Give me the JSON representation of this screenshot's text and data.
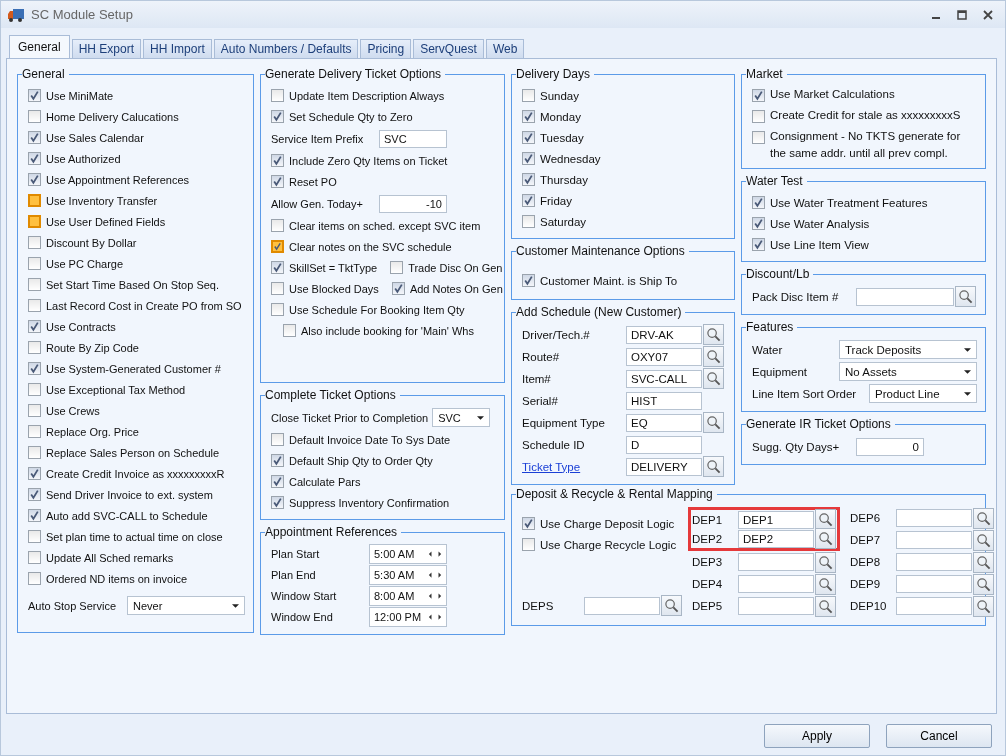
{
  "window": {
    "title": "SC Module Setup"
  },
  "tabs": [
    {
      "label": "General",
      "selected": true
    },
    {
      "label": "HH Export",
      "selected": false
    },
    {
      "label": "HH Import",
      "selected": false
    },
    {
      "label": "Auto Numbers / Defaults",
      "selected": false
    },
    {
      "label": "Pricing",
      "selected": false
    },
    {
      "label": "ServQuest",
      "selected": false
    },
    {
      "label": "Web",
      "selected": false
    }
  ],
  "general": {
    "title": "General",
    "items": [
      {
        "label": "Use MiniMate",
        "checked": true,
        "highlighted": false
      },
      {
        "label": "Home Delivery Calucations",
        "checked": false,
        "highlighted": false
      },
      {
        "label": "Use Sales Calendar",
        "checked": true,
        "highlighted": false
      },
      {
        "label": "Use Authorized",
        "checked": true,
        "highlighted": false
      },
      {
        "label": "Use Appointment References",
        "checked": true,
        "highlighted": false
      },
      {
        "label": "Use Inventory Transfer",
        "checked": false,
        "highlighted": true
      },
      {
        "label": "Use User Defined Fields",
        "checked": false,
        "highlighted": true
      },
      {
        "label": "Discount By Dollar",
        "checked": false,
        "highlighted": false
      },
      {
        "label": "Use PC Charge",
        "checked": false,
        "highlighted": false
      },
      {
        "label": "Set Start Time Based On Stop Seq.",
        "checked": false,
        "highlighted": false
      },
      {
        "label": "Last Record Cost in Create PO from SO",
        "checked": false,
        "highlighted": false
      },
      {
        "label": "Use Contracts",
        "checked": true,
        "highlighted": false
      },
      {
        "label": "Route By Zip Code",
        "checked": false,
        "highlighted": false
      },
      {
        "label": "Use System-Generated Customer #",
        "checked": true,
        "highlighted": false
      },
      {
        "label": "Use Exceptional Tax Method",
        "checked": false,
        "highlighted": false
      },
      {
        "label": "Use Crews",
        "checked": false,
        "highlighted": false
      },
      {
        "label": "Replace Org. Price",
        "checked": false,
        "highlighted": false
      },
      {
        "label": "Replace Sales Person on Schedule",
        "checked": false,
        "highlighted": false
      },
      {
        "label": "Create Credit Invoice as xxxxxxxxxR",
        "checked": true,
        "highlighted": false
      },
      {
        "label": "Send Driver Invoice to ext. system",
        "checked": true,
        "highlighted": false
      },
      {
        "label": "Auto add SVC-CALL to Schedule",
        "checked": true,
        "highlighted": false
      },
      {
        "label": "Set plan time to actual time on close",
        "checked": false,
        "highlighted": false
      },
      {
        "label": "Update All Sched remarks",
        "checked": false,
        "highlighted": false
      },
      {
        "label": "Ordered ND items on invoice",
        "checked": false,
        "highlighted": false
      }
    ],
    "dropdown": {
      "label": "Auto Stop Service",
      "value": "Never"
    }
  },
  "delivery_ticket": {
    "title": "Generate Delivery Ticket Options",
    "rows": [
      {
        "kind": "checkbox",
        "label": "Update Item Description Always",
        "checked": false,
        "highlighted": false
      },
      {
        "kind": "checkbox",
        "label": "Set Schedule Qty to Zero",
        "checked": true,
        "highlighted": false
      },
      {
        "kind": "field",
        "label": "Service Item Prefix",
        "value": "SVC"
      },
      {
        "kind": "checkbox",
        "label": "Include Zero Qty Items on Ticket",
        "checked": true,
        "highlighted": false
      },
      {
        "kind": "checkbox",
        "label": "Reset PO",
        "checked": true,
        "highlighted": false
      },
      {
        "kind": "number",
        "label": "Allow Gen. Today+",
        "value": "-10"
      },
      {
        "kind": "checkbox",
        "label": "Clear items on sched. except SVC item",
        "checked": false,
        "highlighted": false
      },
      {
        "kind": "checkbox",
        "label": "Clear notes on the SVC schedule",
        "checked": true,
        "highlighted": true
      },
      {
        "kind": "pair",
        "items": [
          {
            "label": "SkillSet = TktType",
            "checked": true
          },
          {
            "label": "Trade Disc On Gen",
            "checked": false
          }
        ]
      },
      {
        "kind": "pair",
        "items": [
          {
            "label": "Use Blocked Days",
            "checked": false
          },
          {
            "label": "Add Notes On Gen",
            "checked": true
          }
        ]
      },
      {
        "kind": "checkbox",
        "label": "Use Schedule For Booking Item Qty",
        "checked": false,
        "highlighted": false
      },
      {
        "kind": "subcheckbox",
        "label": "Also include booking for 'Main' Whs",
        "checked": false,
        "highlighted": false
      }
    ]
  },
  "complete_ticket": {
    "title": "Complete Ticket Options",
    "dropdown": {
      "label": "Close Ticket Prior to Completion",
      "value": "SVC"
    },
    "items": [
      {
        "label": "Default Invoice Date To Sys Date",
        "checked": false
      },
      {
        "label": "Default Ship Qty to Order Qty",
        "checked": true
      },
      {
        "label": "Calculate Pars",
        "checked": true
      },
      {
        "label": "Suppress Inventory Confirmation",
        "checked": true
      }
    ]
  },
  "appointment": {
    "title": "Appointment References",
    "times": [
      {
        "label": "Plan Start",
        "value": "5:00 AM"
      },
      {
        "label": "Plan End",
        "value": "5:30 AM"
      },
      {
        "label": "Window Start",
        "value": "8:00 AM"
      },
      {
        "label": "Window End",
        "value": "12:00 PM"
      }
    ]
  },
  "delivery_days": {
    "title": "Delivery Days",
    "days": [
      {
        "label": "Sunday",
        "checked": false
      },
      {
        "label": "Monday",
        "checked": true
      },
      {
        "label": "Tuesday",
        "checked": true
      },
      {
        "label": "Wednesday",
        "checked": true
      },
      {
        "label": "Thursday",
        "checked": true
      },
      {
        "label": "Friday",
        "checked": true
      },
      {
        "label": "Saturday",
        "checked": false
      }
    ]
  },
  "customer_maintenance": {
    "title": "Customer Maintenance Options",
    "items": [
      {
        "label": "Customer Maint. is Ship To",
        "checked": true
      }
    ]
  },
  "add_schedule": {
    "title": "Add Schedule (New Customer)",
    "fields": [
      {
        "label": "Driver/Tech.#",
        "value": "DRV-AK",
        "lookup": true,
        "link": false
      },
      {
        "label": "Route#",
        "value": "OXY07",
        "lookup": true,
        "link": false
      },
      {
        "label": "Item#",
        "value": "SVC-CALL",
        "lookup": true,
        "link": false
      },
      {
        "label": "Serial#",
        "value": "HIST",
        "lookup": false,
        "link": false
      },
      {
        "label": "Equipment Type",
        "value": "EQ",
        "lookup": true,
        "link": false
      },
      {
        "label": "Schedule ID",
        "value": "D",
        "lookup": false,
        "link": false
      },
      {
        "label": "Ticket Type",
        "value": "DELIVERY",
        "lookup": true,
        "link": true
      }
    ]
  },
  "market": {
    "title": "Market",
    "items": [
      {
        "label": "Use Market Calculations",
        "checked": true
      },
      {
        "label": "Create Credit for stale as xxxxxxxxxS",
        "checked": false
      },
      {
        "label": "Consignment - No TKTS generate for the same addr. until all prev compl.",
        "checked": false
      }
    ]
  },
  "water_test": {
    "title": "Water Test",
    "items": [
      {
        "label": "Use Water Treatment Features",
        "checked": true
      },
      {
        "label": "Use Water Analysis",
        "checked": true
      },
      {
        "label": "Use Line Item View",
        "checked": true
      }
    ]
  },
  "discount": {
    "title": "Discount/Lb",
    "field": {
      "label": "Pack Disc Item #"
    }
  },
  "features": {
    "title": "Features",
    "dropdowns": [
      {
        "label": "Water",
        "value": "Track Deposits"
      },
      {
        "label": "Equipment",
        "value": "No Assets"
      },
      {
        "label": "Line Item Sort Order",
        "value": "Product Line"
      }
    ]
  },
  "ir_ticket": {
    "title": "Generate IR Ticket Options",
    "field": {
      "label": "Sugg. Qty Days+",
      "value": "0"
    }
  },
  "deposit": {
    "title": "Deposit & Recycle & Rental Mapping",
    "items": [
      {
        "label": "Use Charge Deposit Logic",
        "checked": true
      },
      {
        "label": "Use Charge Recycle Logic",
        "checked": false
      }
    ],
    "deps": {
      "label": "DEPS"
    },
    "columns": [
      [
        {
          "label": "DEP1",
          "value": "DEP1",
          "highlighted": true
        },
        {
          "label": "DEP2",
          "value": "DEP2",
          "highlighted": true
        },
        {
          "label": "DEP3",
          "highlighted": false
        },
        {
          "label": "DEP4",
          "highlighted": false
        },
        {
          "label": "DEP5",
          "highlighted": false
        }
      ],
      [
        {
          "label": "DEP6",
          "highlighted": false
        },
        {
          "label": "DEP7",
          "highlighted": false
        },
        {
          "label": "DEP8",
          "highlighted": false
        },
        {
          "label": "DEP9",
          "highlighted": false
        },
        {
          "label": "DEP10",
          "highlighted": false
        }
      ]
    ]
  },
  "buttons": [
    {
      "label": "Apply"
    },
    {
      "label": "Cancel"
    }
  ]
}
